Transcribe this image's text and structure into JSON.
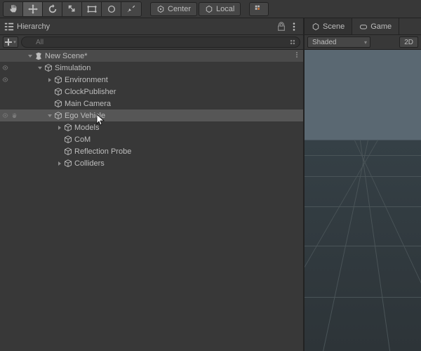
{
  "toolbar": {
    "center_label": "Center",
    "local_label": "Local"
  },
  "hierarchy": {
    "title": "Hierarchy",
    "search_placeholder": "All",
    "tree": [
      {
        "label": "New Scene*",
        "type": "scene",
        "depth": 0,
        "expanded": true,
        "icon": "unity"
      },
      {
        "label": "Simulation",
        "type": "go",
        "depth": 1,
        "expanded": true,
        "vis": true
      },
      {
        "label": "Environment",
        "type": "go",
        "depth": 2,
        "hasChildren": true,
        "vis": true
      },
      {
        "label": "ClockPublisher",
        "type": "go",
        "depth": 2
      },
      {
        "label": "Main Camera",
        "type": "go",
        "depth": 2
      },
      {
        "label": "Ego Vehicle",
        "type": "go",
        "depth": 2,
        "expanded": true,
        "selected": true,
        "vis": true,
        "vis2": true
      },
      {
        "label": "Models",
        "type": "go",
        "depth": 3,
        "hasChildren": true
      },
      {
        "label": "CoM",
        "type": "go",
        "depth": 3
      },
      {
        "label": "Reflection Probe",
        "type": "go",
        "depth": 3
      },
      {
        "label": "Colliders",
        "type": "go",
        "depth": 3,
        "hasChildren": true
      }
    ]
  },
  "scene_tabs": {
    "scene": "Scene",
    "game": "Game"
  },
  "view": {
    "mode": "Shaded",
    "btn_2d": "2D"
  }
}
